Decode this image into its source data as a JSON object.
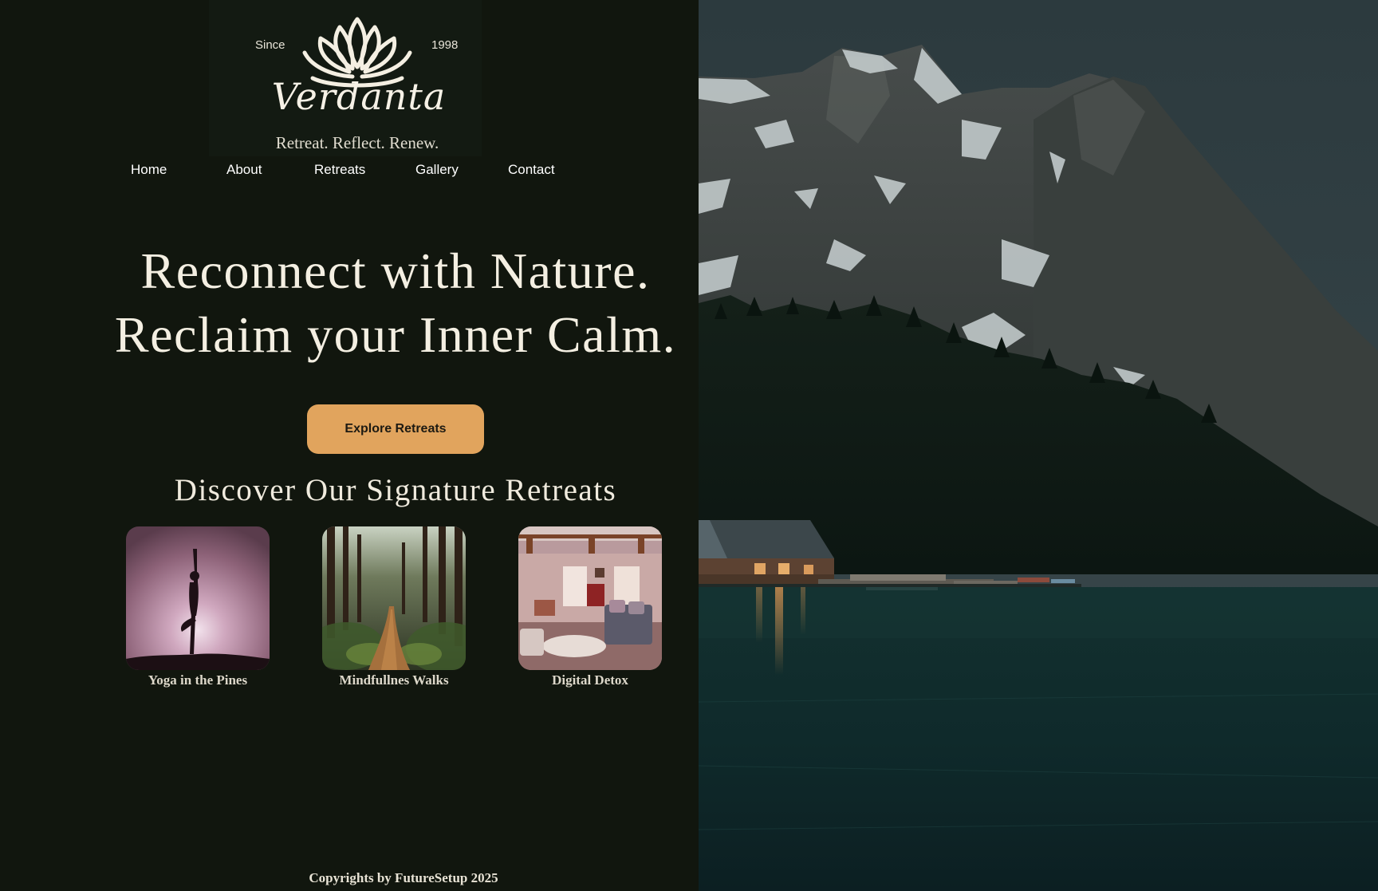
{
  "brand": {
    "since_label": "Since",
    "since_year": "1998",
    "name": "Verdanta",
    "tagline": "Retreat. Reflect. Renew."
  },
  "nav": {
    "items": [
      {
        "label": "Home"
      },
      {
        "label": "About"
      },
      {
        "label": "Retreats"
      },
      {
        "label": "Gallery"
      },
      {
        "label": "Contact"
      }
    ]
  },
  "hero": {
    "line1": "Reconnect with Nature.",
    "line2": "Reclaim your Inner Calm.",
    "cta_label": "Explore Retreats"
  },
  "retreats": {
    "title": "Discover Our Signature Retreats",
    "items": [
      {
        "label": "Yoga in the Pines",
        "image": "yoga-silhouette"
      },
      {
        "label": "Mindfullnes Walks",
        "image": "forest-path"
      },
      {
        "label": "Digital Detox",
        "image": "cozy-room"
      }
    ]
  },
  "footer": {
    "copyright": "Copyrights by FutureSetup 2025"
  },
  "hero_image": {
    "subject": "mountain-lake-with-cabin"
  },
  "colors": {
    "background": "#11160e",
    "accent": "#e1a45d",
    "text": "#f4efe2"
  }
}
